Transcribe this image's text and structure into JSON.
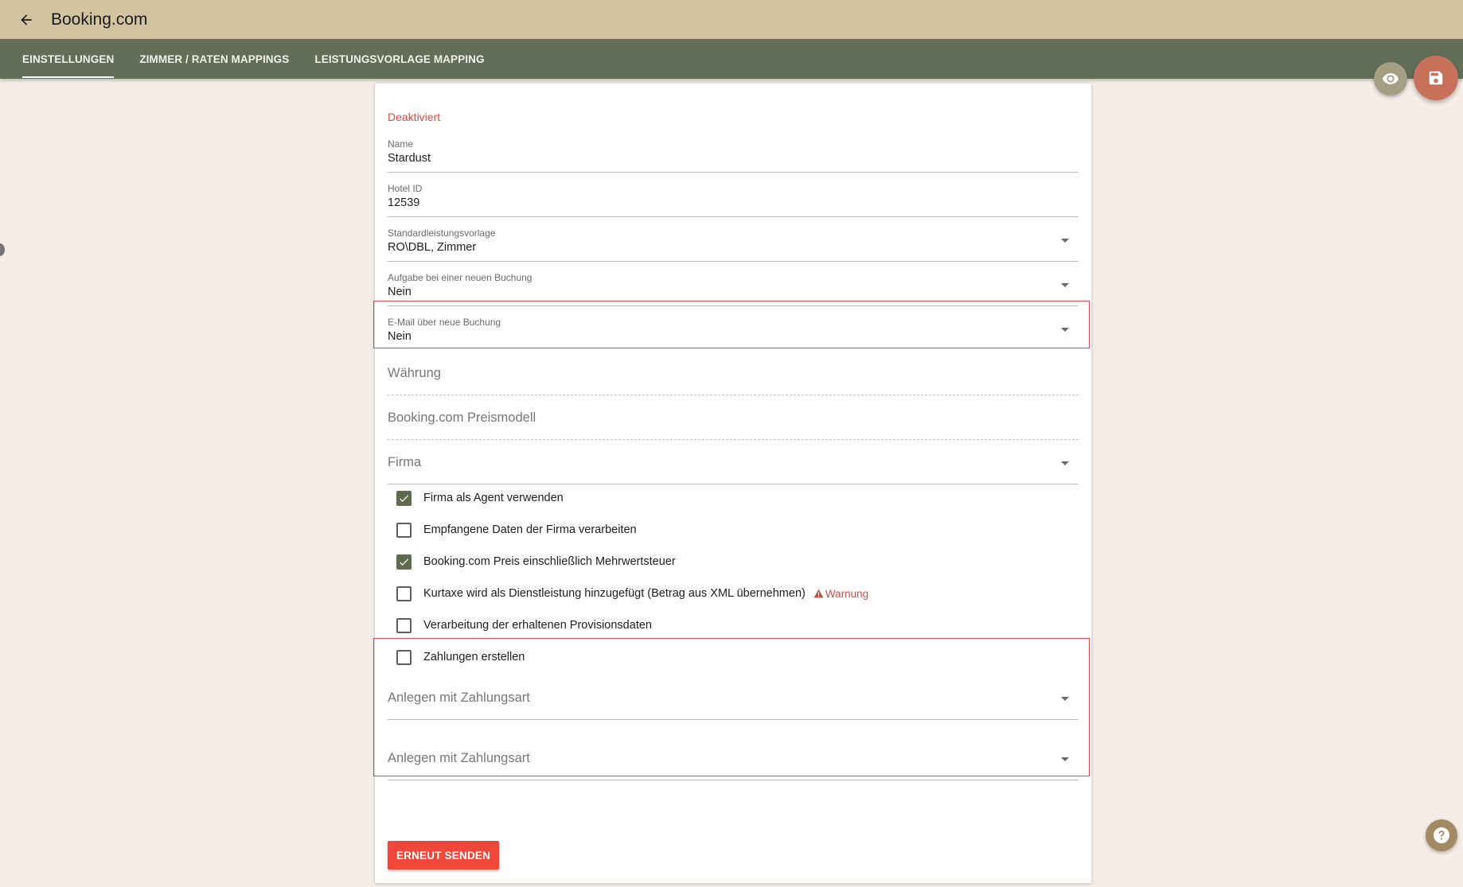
{
  "app": {
    "title": "Booking.com"
  },
  "tabs": [
    {
      "label": "EINSTELLUNGEN",
      "active": true
    },
    {
      "label": "ZIMMER / RATEN MAPPINGS",
      "active": false
    },
    {
      "label": "LEISTUNGSVORLAGE MAPPING",
      "active": false
    }
  ],
  "form": {
    "status": "Deaktiviert",
    "name": {
      "label": "Name",
      "value": "Stardust"
    },
    "hotel_id": {
      "label": "Hotel ID",
      "value": "12539"
    },
    "default_template": {
      "label": "Standardleistungsvorlage",
      "value": "RO\\DBL, Zimmer"
    },
    "task_new_booking": {
      "label": "Aufgabe bei einer neuen Buchung",
      "value": "Nein"
    },
    "email_new_booking": {
      "label": "E-Mail über neue Buchung",
      "value": "Nein"
    },
    "currency": {
      "placeholder": "Währung"
    },
    "price_model": {
      "placeholder": "Booking.com Preismodell"
    },
    "company": {
      "placeholder": "Firma"
    },
    "checkboxes": [
      {
        "label": "Firma als Agent verwenden",
        "checked": true
      },
      {
        "label": "Empfangene Daten der Firma verarbeiten",
        "checked": false
      },
      {
        "label": "Booking.com Preis einschließlich Mehrwertsteuer",
        "checked": true
      },
      {
        "label": "Kurtaxe wird als Dienstleistung hinzugefügt (Betrag aus XML übernehmen)",
        "checked": false,
        "warning": "Warnung"
      },
      {
        "label": "Verarbeitung der erhaltenen Provisionsdaten",
        "checked": false
      },
      {
        "label": "Zahlungen erstellen",
        "checked": false
      }
    ],
    "payment_type_1": {
      "placeholder": "Anlegen mit Zahlungsart"
    },
    "payment_type_2": {
      "placeholder": "Anlegen mit Zahlungsart"
    },
    "resend_button": "ERNEUT SENDEN"
  },
  "colors": {
    "titlebar": "#d2c3a1",
    "tabbar": "#636e58",
    "background": "#f5ede6",
    "accent_red": "#f0473b",
    "checkbox_checked": "#5e6b4c",
    "highlight": "#e4474b"
  },
  "icons": {
    "back": "arrow-left-icon",
    "preview": "eye-icon",
    "save": "floppy-disk-icon",
    "help": "question-icon",
    "warning": "warning-triangle-icon"
  }
}
